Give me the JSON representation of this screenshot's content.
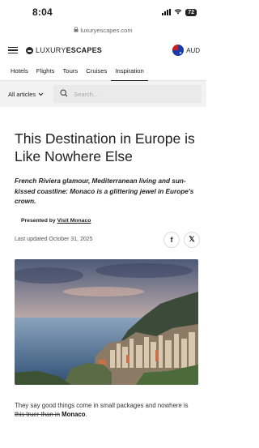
{
  "status": {
    "time": "8:04",
    "battery": "72"
  },
  "browser": {
    "url": "luxuryescapes.com"
  },
  "header": {
    "logo_light": "LUXURY",
    "logo_bold": "ESCAPES",
    "currency": "AUD"
  },
  "nav": {
    "items": [
      "Hotels",
      "Flights",
      "Tours",
      "Cruises",
      "Inspiration"
    ],
    "active": "Inspiration"
  },
  "filters": {
    "articles_label": "All articles",
    "search_placeholder": "Search..."
  },
  "article": {
    "title": "This Destination in Europe is Like Nowhere Else",
    "intro": "French Riviera glamour, Mediterranean living and sun-kissed coastline: Monaco is a glittering jewel in Europe's crown.",
    "presented_prefix": "Presented by ",
    "presented_link": "Visit Monaco",
    "updated": "Last updated October 31, 2025",
    "body_start": "They say good things come in small packages and nowhere is ",
    "body_highlight": "this truer than in",
    "body_bold": "Monaco",
    "body_end": "."
  },
  "icons": {
    "share1": "facebook-icon",
    "share2": "x-icon"
  },
  "colors": {
    "accent": "#111111",
    "filter_bg": "#f2f2f2"
  }
}
